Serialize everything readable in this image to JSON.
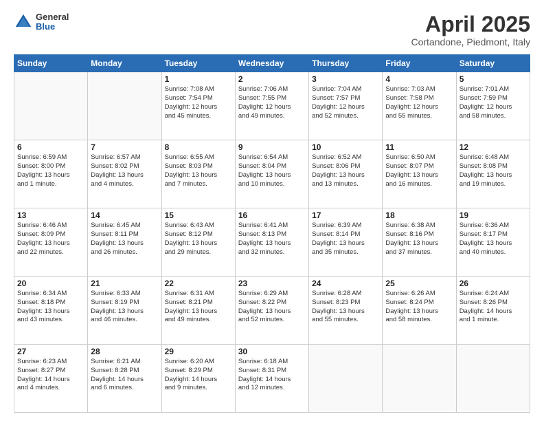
{
  "header": {
    "logo_general": "General",
    "logo_blue": "Blue",
    "title": "April 2025",
    "subtitle": "Cortandone, Piedmont, Italy"
  },
  "calendar": {
    "days_of_week": [
      "Sunday",
      "Monday",
      "Tuesday",
      "Wednesday",
      "Thursday",
      "Friday",
      "Saturday"
    ],
    "weeks": [
      [
        {
          "day": "",
          "info": ""
        },
        {
          "day": "",
          "info": ""
        },
        {
          "day": "1",
          "info": "Sunrise: 7:08 AM\nSunset: 7:54 PM\nDaylight: 12 hours\nand 45 minutes."
        },
        {
          "day": "2",
          "info": "Sunrise: 7:06 AM\nSunset: 7:55 PM\nDaylight: 12 hours\nand 49 minutes."
        },
        {
          "day": "3",
          "info": "Sunrise: 7:04 AM\nSunset: 7:57 PM\nDaylight: 12 hours\nand 52 minutes."
        },
        {
          "day": "4",
          "info": "Sunrise: 7:03 AM\nSunset: 7:58 PM\nDaylight: 12 hours\nand 55 minutes."
        },
        {
          "day": "5",
          "info": "Sunrise: 7:01 AM\nSunset: 7:59 PM\nDaylight: 12 hours\nand 58 minutes."
        }
      ],
      [
        {
          "day": "6",
          "info": "Sunrise: 6:59 AM\nSunset: 8:00 PM\nDaylight: 13 hours\nand 1 minute."
        },
        {
          "day": "7",
          "info": "Sunrise: 6:57 AM\nSunset: 8:02 PM\nDaylight: 13 hours\nand 4 minutes."
        },
        {
          "day": "8",
          "info": "Sunrise: 6:55 AM\nSunset: 8:03 PM\nDaylight: 13 hours\nand 7 minutes."
        },
        {
          "day": "9",
          "info": "Sunrise: 6:54 AM\nSunset: 8:04 PM\nDaylight: 13 hours\nand 10 minutes."
        },
        {
          "day": "10",
          "info": "Sunrise: 6:52 AM\nSunset: 8:06 PM\nDaylight: 13 hours\nand 13 minutes."
        },
        {
          "day": "11",
          "info": "Sunrise: 6:50 AM\nSunset: 8:07 PM\nDaylight: 13 hours\nand 16 minutes."
        },
        {
          "day": "12",
          "info": "Sunrise: 6:48 AM\nSunset: 8:08 PM\nDaylight: 13 hours\nand 19 minutes."
        }
      ],
      [
        {
          "day": "13",
          "info": "Sunrise: 6:46 AM\nSunset: 8:09 PM\nDaylight: 13 hours\nand 22 minutes."
        },
        {
          "day": "14",
          "info": "Sunrise: 6:45 AM\nSunset: 8:11 PM\nDaylight: 13 hours\nand 26 minutes."
        },
        {
          "day": "15",
          "info": "Sunrise: 6:43 AM\nSunset: 8:12 PM\nDaylight: 13 hours\nand 29 minutes."
        },
        {
          "day": "16",
          "info": "Sunrise: 6:41 AM\nSunset: 8:13 PM\nDaylight: 13 hours\nand 32 minutes."
        },
        {
          "day": "17",
          "info": "Sunrise: 6:39 AM\nSunset: 8:14 PM\nDaylight: 13 hours\nand 35 minutes."
        },
        {
          "day": "18",
          "info": "Sunrise: 6:38 AM\nSunset: 8:16 PM\nDaylight: 13 hours\nand 37 minutes."
        },
        {
          "day": "19",
          "info": "Sunrise: 6:36 AM\nSunset: 8:17 PM\nDaylight: 13 hours\nand 40 minutes."
        }
      ],
      [
        {
          "day": "20",
          "info": "Sunrise: 6:34 AM\nSunset: 8:18 PM\nDaylight: 13 hours\nand 43 minutes."
        },
        {
          "day": "21",
          "info": "Sunrise: 6:33 AM\nSunset: 8:19 PM\nDaylight: 13 hours\nand 46 minutes."
        },
        {
          "day": "22",
          "info": "Sunrise: 6:31 AM\nSunset: 8:21 PM\nDaylight: 13 hours\nand 49 minutes."
        },
        {
          "day": "23",
          "info": "Sunrise: 6:29 AM\nSunset: 8:22 PM\nDaylight: 13 hours\nand 52 minutes."
        },
        {
          "day": "24",
          "info": "Sunrise: 6:28 AM\nSunset: 8:23 PM\nDaylight: 13 hours\nand 55 minutes."
        },
        {
          "day": "25",
          "info": "Sunrise: 6:26 AM\nSunset: 8:24 PM\nDaylight: 13 hours\nand 58 minutes."
        },
        {
          "day": "26",
          "info": "Sunrise: 6:24 AM\nSunset: 8:26 PM\nDaylight: 14 hours\nand 1 minute."
        }
      ],
      [
        {
          "day": "27",
          "info": "Sunrise: 6:23 AM\nSunset: 8:27 PM\nDaylight: 14 hours\nand 4 minutes."
        },
        {
          "day": "28",
          "info": "Sunrise: 6:21 AM\nSunset: 8:28 PM\nDaylight: 14 hours\nand 6 minutes."
        },
        {
          "day": "29",
          "info": "Sunrise: 6:20 AM\nSunset: 8:29 PM\nDaylight: 14 hours\nand 9 minutes."
        },
        {
          "day": "30",
          "info": "Sunrise: 6:18 AM\nSunset: 8:31 PM\nDaylight: 14 hours\nand 12 minutes."
        },
        {
          "day": "",
          "info": ""
        },
        {
          "day": "",
          "info": ""
        },
        {
          "day": "",
          "info": ""
        }
      ]
    ]
  }
}
